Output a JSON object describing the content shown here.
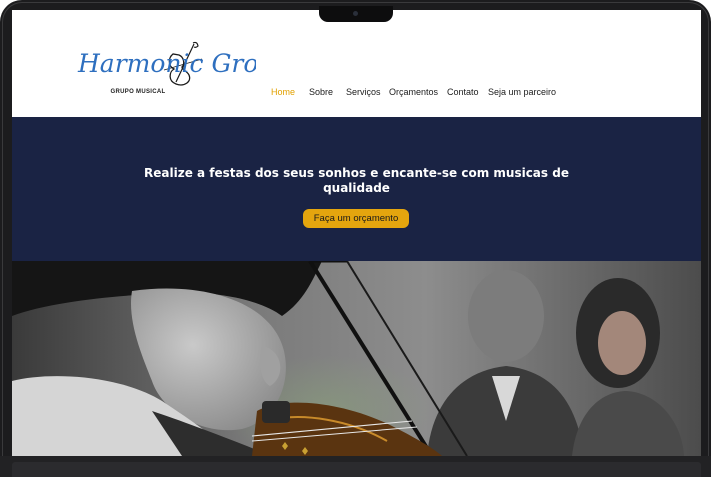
{
  "brand": {
    "logo_script": "Harmonic Group",
    "logo_subtitle": "GRUPO MUSICAL"
  },
  "nav": {
    "items": [
      {
        "label": "Home",
        "active": true
      },
      {
        "label": "Sobre",
        "active": false
      },
      {
        "label": "Serviços",
        "active": false
      },
      {
        "label": "Orçamentos",
        "active": false
      },
      {
        "label": "Contato",
        "active": false
      },
      {
        "label": "Seja um parceiro",
        "active": false
      }
    ]
  },
  "hero": {
    "title_line1": "Realize a festas dos seus sonhos e encante-se com musicas de",
    "title_line2": "qualidade",
    "cta_label": "Faça um orçamento"
  },
  "colors": {
    "accent": "#e4a50e",
    "hero_background": "#1a2344",
    "logo_blue": "#2e6fbf",
    "nav_text": "#1b1b1b"
  },
  "icons": {
    "logo_mark": "violin-icon"
  }
}
